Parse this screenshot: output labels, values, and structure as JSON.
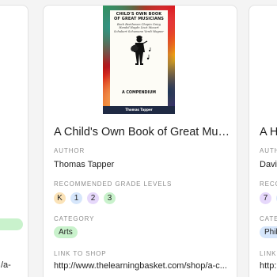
{
  "cards": {
    "left": {
      "link_fragment": "/a-",
      "pill_color": "#c9f2cc"
    },
    "main": {
      "cover": {
        "title": "CHILD'S OWN BOOK OF GREAT MUSICIANS",
        "subtitle": "Bach Beethoven Chopin Grieg Handel Haydn Liszt Mozart Schubert Schumann Verdi Wagner",
        "bottom_text": "A COMPENDIUM",
        "author": "Thomas Tapper"
      },
      "title": "A Child's Own Book of Great Musici...",
      "author_label": "AUTHOR",
      "author": "Thomas Tapper",
      "grade_label": "RECOMMENDED GRADE LEVELS",
      "grades": [
        {
          "label": "K",
          "color": "#fbe3b8"
        },
        {
          "label": "1",
          "color": "#d6e6fb"
        },
        {
          "label": "2",
          "color": "#e6d8fb"
        },
        {
          "label": "3",
          "color": "#c9f2cc"
        }
      ],
      "category_label": "CATEGORY",
      "category": "Arts",
      "category_color": "#c9f2cc",
      "shop_label": "LINK TO SHOP",
      "shop_link": "http://www.thelearningbasket.com/shop/a-c..."
    },
    "right": {
      "title": "A Hi",
      "author_label": "AUTHO",
      "author": "David",
      "grade_label": "RECOM",
      "grades": [
        {
          "label": "7",
          "color": "#e6d8fb"
        },
        {
          "label": "",
          "color": "#d6e6fb"
        }
      ],
      "category_label": "CATEG",
      "category": "Phili",
      "category_color": "#d6e6fb",
      "shop_label": "LINK T",
      "shop_link": "http:"
    }
  }
}
